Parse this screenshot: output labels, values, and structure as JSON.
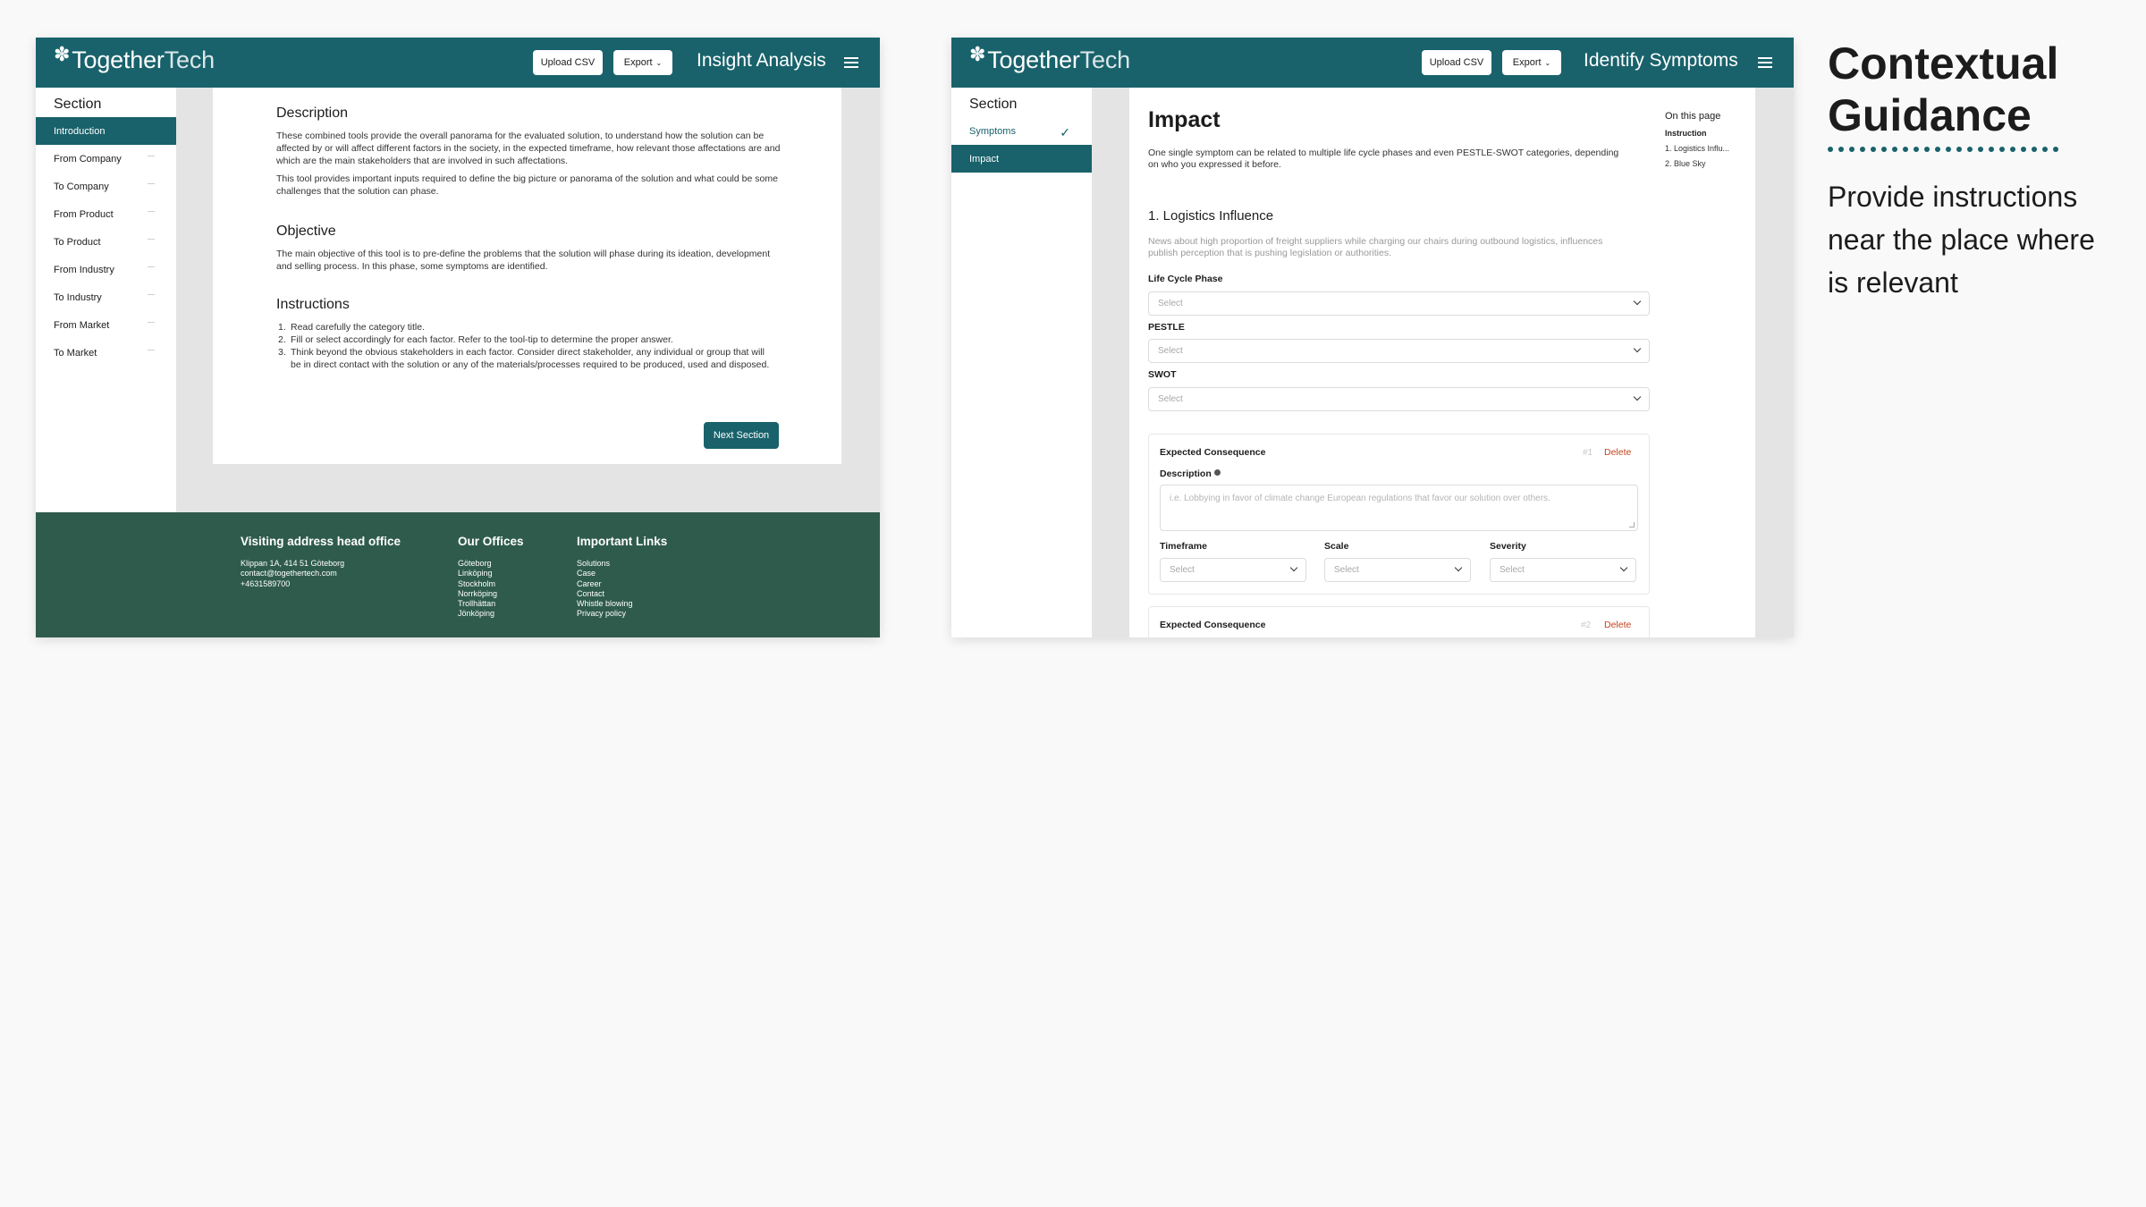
{
  "colors": {
    "brand_teal": "#19626b",
    "footer_green": "#2f5b4d",
    "delete_orange": "#c2451e",
    "page_background": "#f9f9f9"
  },
  "brand": {
    "logo_bold": "Together",
    "logo_light": "Tech",
    "logo_icon": "gear-icon"
  },
  "screen1": {
    "toolbar": {
      "upload_csv": "Upload CSV",
      "export": "Export",
      "title": "Insight Analysis"
    },
    "sidebar": {
      "heading": "Section",
      "items": [
        {
          "label": "Introduction",
          "active": true
        },
        {
          "label": "From Company"
        },
        {
          "label": "To Company"
        },
        {
          "label": "From Product"
        },
        {
          "label": "To Product"
        },
        {
          "label": "From Industry"
        },
        {
          "label": "To Industry"
        },
        {
          "label": "From Market"
        },
        {
          "label": "To Market"
        }
      ]
    },
    "content": {
      "description_heading": "Description",
      "description_p1": "These combined tools provide the overall panorama for the evaluated solution, to understand how the solution can be affected by or will affect different factors in the society, in the expected timeframe, how relevant those affectations are and which are the main stakeholders that are involved in such affectations.",
      "description_p2": "This tool provides important inputs required to define the big picture or panorama of the solution and what could be some challenges that the solution can phase.",
      "objective_heading": "Objective",
      "objective_p": "The main objective of this tool is to pre-define the problems that the solution will phase during its ideation, development and selling process. In this phase, some symptoms are identified.",
      "instructions_heading": "Instructions",
      "instructions": [
        "Read carefully the category title.",
        "Fill or select accordingly for each factor. Refer to the tool-tip to determine the proper answer.",
        "Think beyond the obvious stakeholders in each factor. Consider direct stakeholder, any individual or group that will be in direct contact with the solution or any of the materials/processes required to be produced, used and disposed."
      ],
      "next_button": "Next Section"
    },
    "footer": {
      "visiting": {
        "title": "Visiting address head office",
        "lines": [
          "Klippan 1A, 414 51 Göteborg",
          "contact@togethertech.com",
          "+4631589700"
        ]
      },
      "offices": {
        "title": "Our Offices",
        "lines": [
          "Göteborg",
          "Linköping",
          "Stockholm",
          "Norrköping",
          "Trollhättan",
          "Jönköping"
        ]
      },
      "links": {
        "title": "Important Links",
        "lines": [
          "Solutions",
          "Case",
          "Career",
          "Contact",
          "Whistle blowing",
          "Privacy policy"
        ]
      }
    }
  },
  "screen2": {
    "toolbar": {
      "upload_csv": "Upload CSV",
      "export": "Export",
      "title": "Identify Symptoms"
    },
    "sidebar": {
      "heading": "Section",
      "items": [
        {
          "label": "Symptoms",
          "completed": true
        },
        {
          "label": "Impact",
          "active": true
        }
      ]
    },
    "content": {
      "title": "Impact",
      "intro": "One single symptom can be related to multiple life cycle phases and even PESTLE-SWOT categories, depending on who you expressed it before.",
      "section_heading": "1. Logistics Influence",
      "section_desc": "News about high proportion of freight suppliers while charging our chairs during outbound logistics, influences publish perception that is pushing legislation or authorities.",
      "fields": {
        "life_cycle_label": "Life Cycle Phase",
        "pestle_label": "PESTLE",
        "swot_label": "SWOT",
        "select_placeholder": "Select"
      },
      "consequences": [
        {
          "title": "Expected Consequence",
          "number": "#1",
          "delete": "Delete",
          "description_label": "Description",
          "description_placeholder": "i.e. Lobbying in favor of climate change European regulations that favor our solution over others.",
          "timeframe_label": "Timeframe",
          "scale_label": "Scale",
          "severity_label": "Severity"
        },
        {
          "title": "Expected Consequence",
          "number": "#2",
          "delete": "Delete"
        }
      ]
    },
    "toc": {
      "heading": "On this page",
      "items": [
        "Instruction",
        "1. Logistics Influ...",
        "2. Blue Sky"
      ]
    }
  },
  "guidance": {
    "title": "Contextual Guidance",
    "body": "Provide instructions near the place where is relevant"
  }
}
